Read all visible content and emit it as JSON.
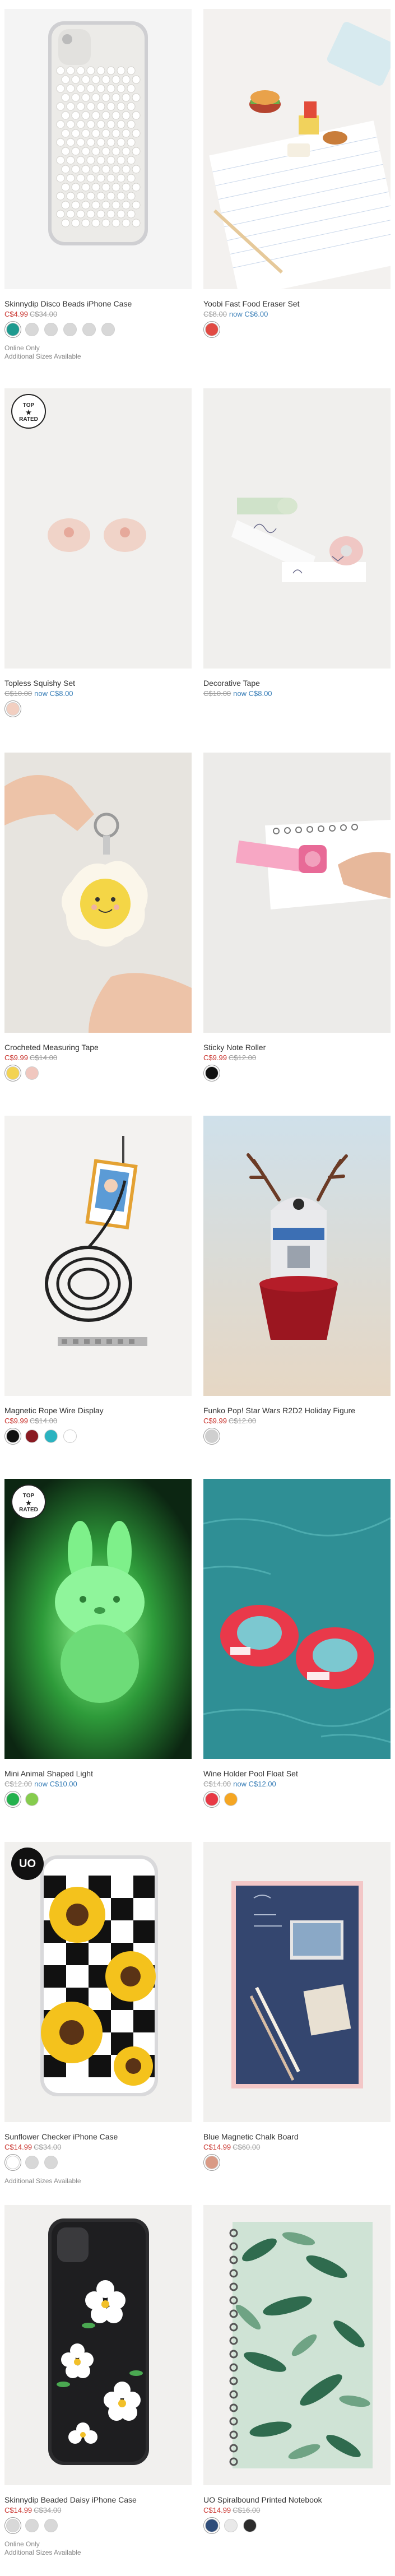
{
  "products": [
    {
      "name": "Skinnydip Disco Beads iPhone Case",
      "price_sale": "C$4.99",
      "price_was": "C$34.00",
      "price_now": "",
      "notes": [
        "Online Only",
        "Additional Sizes Available"
      ],
      "swatch_colors": [
        "#1e9a8f",
        "#d8d8d8",
        "#d8d8d8",
        "#d8d8d8",
        "#d8d8d8",
        "#d8d8d8"
      ],
      "selected_swatch": 0,
      "badge": ""
    },
    {
      "name": "Yoobi Fast Food Eraser Set",
      "price_sale": "",
      "price_was": "C$8.00",
      "price_now": "now C$6.00",
      "notes": [],
      "swatch_colors": [
        "#e14a43"
      ],
      "selected_swatch": 0,
      "badge": ""
    },
    {
      "name": "Topless Squishy Set",
      "price_sale": "",
      "price_was": "C$10.00",
      "price_now": "now C$8.00",
      "notes": [],
      "swatch_colors": [
        "#f2cfc1"
      ],
      "selected_swatch": 0,
      "badge": "TOP RATED"
    },
    {
      "name": "Decorative Tape",
      "price_sale": "",
      "price_was": "C$10.00",
      "price_now": "now C$8.00",
      "notes": [],
      "swatch_colors": [],
      "selected_swatch": -1,
      "badge": ""
    },
    {
      "name": "Crocheted Measuring Tape",
      "price_sale": "C$9.99",
      "price_was": "C$14.00",
      "price_now": "",
      "notes": [],
      "swatch_colors": [
        "#f3d352",
        "#f0c7bf"
      ],
      "selected_swatch": 0,
      "badge": ""
    },
    {
      "name": "Sticky Note Roller",
      "price_sale": "C$9.99",
      "price_was": "C$12.00",
      "price_now": "",
      "notes": [],
      "swatch_colors": [
        "#111111"
      ],
      "selected_swatch": 0,
      "badge": ""
    },
    {
      "name": "Magnetic Rope Wire Display",
      "price_sale": "C$9.99",
      "price_was": "C$14.00",
      "price_now": "",
      "notes": [],
      "swatch_colors": [
        "#111111",
        "#8a1a22",
        "#2bb3c0",
        "#ffffff"
      ],
      "selected_swatch": 0,
      "badge": ""
    },
    {
      "name": "Funko Pop! Star Wars R2D2 Holiday Figure",
      "price_sale": "C$9.99",
      "price_was": "C$12.00",
      "price_now": "",
      "notes": [],
      "swatch_colors": [
        "#cfcfcf"
      ],
      "selected_swatch": 0,
      "badge": ""
    },
    {
      "name": "Mini Animal Shaped Light",
      "price_sale": "",
      "price_was": "C$12.00",
      "price_now": "now C$10.00",
      "notes": [],
      "swatch_colors": [
        "#23b14d",
        "#86cc4e"
      ],
      "selected_swatch": 0,
      "badge": "TOP RATED"
    },
    {
      "name": "Wine Holder Pool Float Set",
      "price_sale": "",
      "price_was": "C$14.00",
      "price_now": "now C$12.00",
      "notes": [],
      "swatch_colors": [
        "#e83945",
        "#f5a623"
      ],
      "selected_swatch": 0,
      "badge": ""
    },
    {
      "name": "Sunflower Checker iPhone Case",
      "price_sale": "C$14.99",
      "price_was": "C$34.00",
      "price_now": "",
      "notes": [
        "Additional Sizes Available"
      ],
      "swatch_colors": [
        "#ffffff",
        "#d8d8d8",
        "#d8d8d8"
      ],
      "selected_swatch": 0,
      "badge": "UO"
    },
    {
      "name": "Blue Magnetic Chalk Board",
      "price_sale": "C$14.99",
      "price_was": "C$60.00",
      "price_now": "",
      "notes": [],
      "swatch_colors": [
        "#d99a85"
      ],
      "selected_swatch": 0,
      "badge": ""
    },
    {
      "name": "Skinnydip Beaded Daisy iPhone Case",
      "price_sale": "C$14.99",
      "price_was": "C$34.00",
      "price_now": "",
      "notes": [
        "Online Only",
        "Additional Sizes Available"
      ],
      "swatch_colors": [
        "#d8d8d8",
        "#d8d8d8",
        "#d8d8d8"
      ],
      "selected_swatch": 0,
      "badge": ""
    },
    {
      "name": "UO Spiralbound Printed Notebook",
      "price_sale": "C$14.99",
      "price_was": "C$16.00",
      "price_now": "",
      "notes": [],
      "swatch_colors": [
        "#2f4d7a",
        "#e9e9e9",
        "#2c2c2c"
      ],
      "selected_swatch": 0,
      "badge": ""
    }
  ]
}
